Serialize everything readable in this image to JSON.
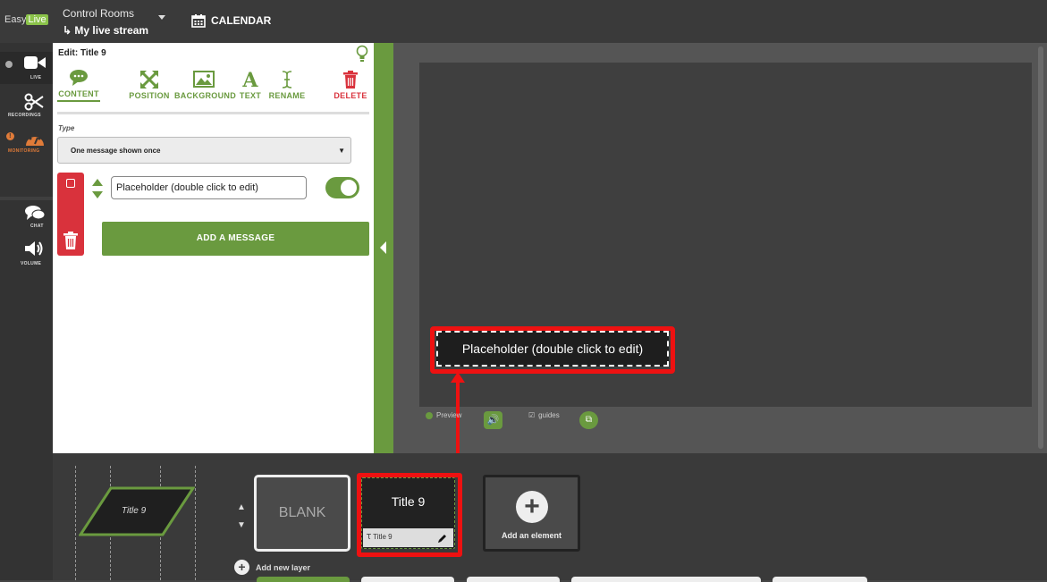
{
  "topbar": {
    "logo": {
      "easy": "Easy",
      "live": "Live"
    },
    "control_rooms_label": "Control Rooms",
    "stream_name": "My live stream",
    "calendar_label": "CALENDAR"
  },
  "rail": {
    "items": [
      {
        "label": "LIVE",
        "icon": "video-camera-icon"
      },
      {
        "label": "RECORDINGS",
        "icon": "scissors-icon"
      },
      {
        "label": "MONITORING",
        "icon": "speedometer-icon"
      },
      {
        "label": "CHAT",
        "icon": "chat-bubbles-icon"
      },
      {
        "label": "VOLUME",
        "icon": "speaker-icon"
      }
    ],
    "colors": {
      "monitoring": "#e07b39"
    }
  },
  "panel": {
    "title": "Edit: Title 9",
    "tabs": [
      {
        "label": "CONTENT",
        "icon": "speech-bubble-icon"
      },
      {
        "label": "POSITION",
        "icon": "expand-arrows-icon"
      },
      {
        "label": "BACKGROUND",
        "icon": "image-icon"
      },
      {
        "label": "TEXT",
        "icon": "letter-a-icon"
      },
      {
        "label": "RENAME",
        "icon": "text-cursor-icon"
      },
      {
        "label": "DELETE",
        "icon": "trash-icon"
      }
    ],
    "type_label": "Type",
    "type_value": "One message shown once",
    "message_value": "Placeholder (double click to edit)",
    "add_message_label": "ADD A MESSAGE"
  },
  "canvas": {
    "placeholder_text": "Placeholder (double click to edit)",
    "preview_label": "Preview",
    "guides_label": "guides"
  },
  "dock": {
    "layer_name": "Title 9",
    "blank_label": "BLANK",
    "title_card": {
      "title": "Title 9",
      "footer": "Title 9"
    },
    "add_element_label": "Add an element",
    "add_layer_label": "Add new layer"
  },
  "colors": {
    "accent": "#6a9a3f",
    "highlight": "#ee1111",
    "danger": "#d9323c"
  }
}
